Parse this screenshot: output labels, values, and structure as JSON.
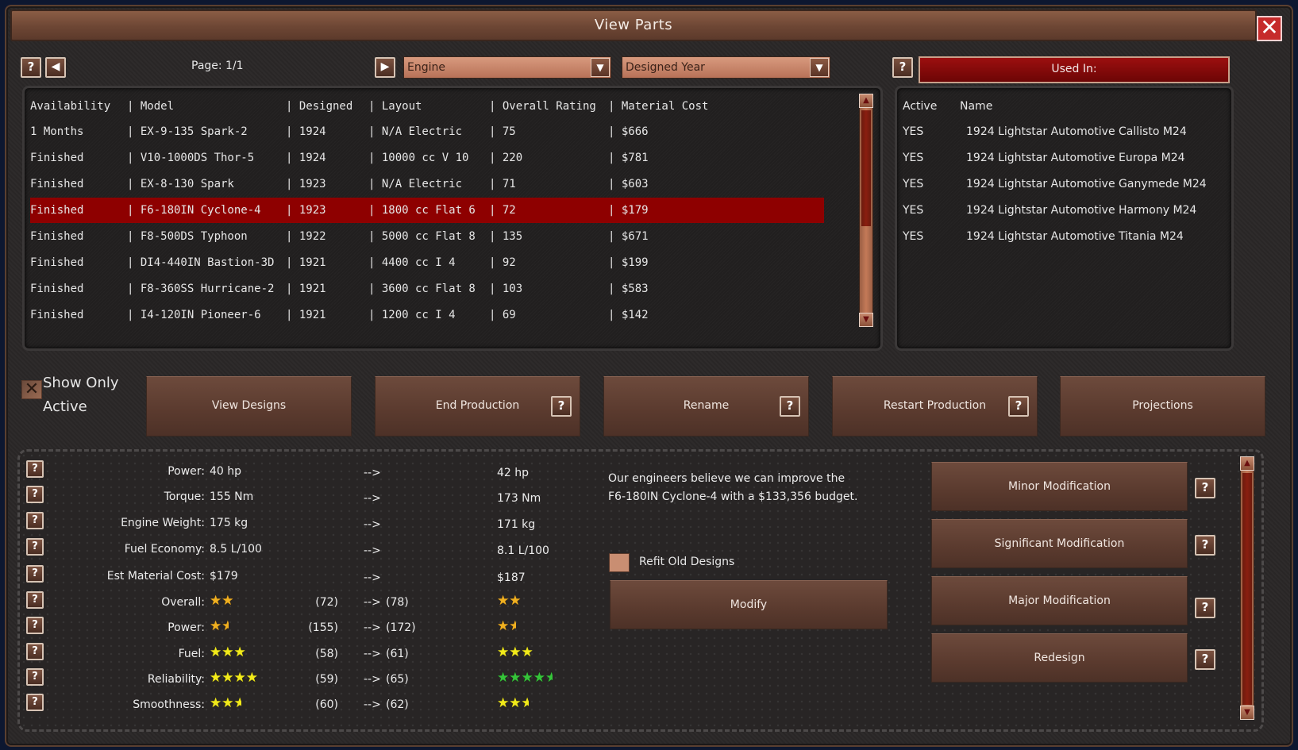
{
  "window": {
    "title": "View Parts",
    "close_icon": "close-icon"
  },
  "toolbar": {
    "page_label": "Page: 1/1",
    "part_type_selected": "Engine",
    "sort_selected": "Designed Year",
    "prev_glyph": "◀",
    "next_glyph": "▶",
    "help_glyph": "?",
    "dropdown_glyph": "▼"
  },
  "parts_table": {
    "headers": [
      "Availability",
      "| Model",
      "| Designed",
      "| Layout",
      "| Overall Rating",
      "| Material Cost"
    ],
    "rows": [
      [
        "1 Months",
        "| EX-9-135 Spark-2",
        "| 1924",
        "| N/A Electric",
        "| 75",
        "| $666"
      ],
      [
        "Finished",
        "| V10-1000DS Thor-5",
        "| 1924",
        "| 10000 cc V 10",
        "| 220",
        "| $781"
      ],
      [
        "Finished",
        "| EX-8-130 Spark",
        "| 1923",
        "| N/A Electric",
        "| 71",
        "| $603"
      ],
      [
        "Finished",
        "| F6-180IN Cyclone-4",
        "| 1923",
        "| 1800 cc Flat 6",
        "| 72",
        "| $179"
      ],
      [
        "Finished",
        "| F8-500DS Typhoon",
        "| 1922",
        "| 5000 cc Flat 8",
        "| 135",
        "| $671"
      ],
      [
        "Finished",
        "| DI4-440IN Bastion-3D",
        "| 1921",
        "| 4400 cc I 4",
        "| 92",
        "| $199"
      ],
      [
        "Finished",
        "| F8-360SS Hurricane-2",
        "| 1921",
        "| 3600 cc Flat 8",
        "| 103",
        "| $583"
      ],
      [
        "Finished",
        "| I4-120IN Pioneer-6",
        "| 1921",
        "| 1200 cc I 4",
        "| 69",
        "| $142"
      ]
    ],
    "selected_index": 3
  },
  "used_in": {
    "header": "Used In:",
    "columns": [
      "Active",
      "Name"
    ],
    "rows": [
      [
        "YES",
        "1924 Lightstar Automotive Callisto M24"
      ],
      [
        "YES",
        "1924 Lightstar Automotive Europa M24"
      ],
      [
        "YES",
        "1924 Lightstar Automotive Ganymede M24"
      ],
      [
        "YES",
        "1924 Lightstar Automotive Harmony M24"
      ],
      [
        "YES",
        "1924 Lightstar Automotive Titania M24"
      ]
    ]
  },
  "filters": {
    "show_only_active_line1": "Show Only",
    "show_only_active_line2": "Active",
    "show_only_active_checked": false
  },
  "actions": {
    "view_designs": "View Designs",
    "end_production": "End Production",
    "rename": "Rename",
    "restart_production": "Restart Production",
    "projections": "Projections"
  },
  "stats": [
    {
      "label": "Power:",
      "current": "40 hp",
      "paren": "",
      "new": "42 hp"
    },
    {
      "label": "Torque:",
      "current": "155 Nm",
      "paren": "",
      "new": "173 Nm"
    },
    {
      "label": "Engine Weight:",
      "current": "175 kg",
      "paren": "",
      "new": "171 kg"
    },
    {
      "label": "Fuel Economy:",
      "current": "8.5 L/100",
      "paren": "",
      "new": "8.1 L/100"
    },
    {
      "label": "Est Material Cost:",
      "current": "$179",
      "paren": "",
      "new": "$187"
    }
  ],
  "ratings": [
    {
      "label": "Overall:",
      "paren": "(72) -->",
      "cur_stars": 2,
      "new_stars": 2,
      "color": "gold",
      "cur_value": "(72)",
      "new_value": "(78)"
    },
    {
      "label": "Power:",
      "paren": "(155) -->",
      "cur_stars": 1.5,
      "new_stars": 1.5,
      "color": "gold",
      "cur_value": "(155)",
      "new_value": "(172)"
    },
    {
      "label": "Fuel:",
      "paren": "(58) -->",
      "cur_stars": 3,
      "new_stars": 3,
      "color": "yellow",
      "cur_value": "(58)",
      "new_value": "(61)"
    },
    {
      "label": "Reliability:",
      "paren": "(59) -->",
      "cur_stars": 4,
      "new_stars": 4.5,
      "color_cur": "yellow",
      "color_new": "green",
      "cur_value": "(59)",
      "new_value": "(65)"
    },
    {
      "label": "Smoothness:",
      "paren": "(60) -->",
      "cur_stars": 2.5,
      "new_stars": 2.5,
      "color": "yellow",
      "cur_value": "(60)",
      "new_value": "(62)"
    }
  ],
  "arrow_text": "-->",
  "modification": {
    "message_line1": "Our engineers believe we can improve the",
    "message_line2": "F6-180IN Cyclone-4 with a $133,356 budget.",
    "refit_label": "Refit Old Designs",
    "modify_label": "Modify",
    "minor": "Minor Modification",
    "significant": "Significant Modification",
    "major": "Major Modification",
    "redesign": "Redesign"
  },
  "colors": {
    "accent_red": "#8e0000",
    "button_brown": "#5a3a2e",
    "close_red": "#c62b2b"
  }
}
